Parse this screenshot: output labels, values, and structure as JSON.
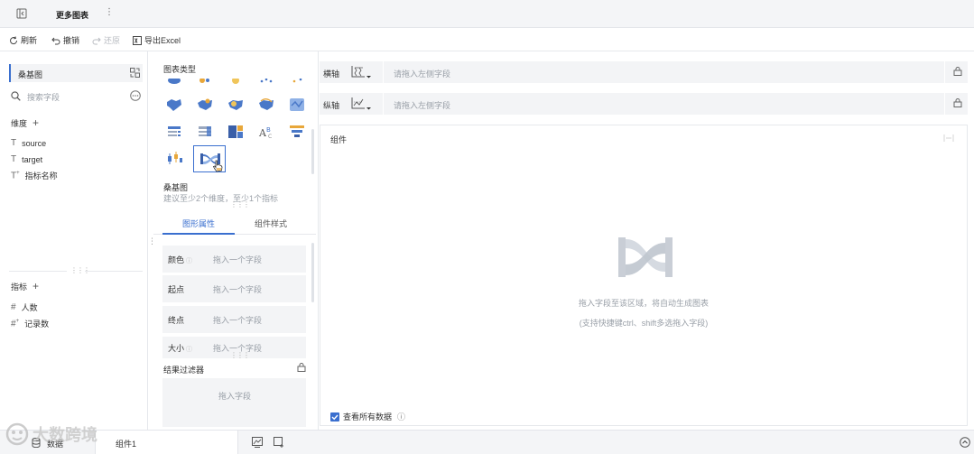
{
  "header": {
    "title": "更多图表",
    "menu_glyph": "⋮"
  },
  "toolbar": {
    "refresh": "刷新",
    "undo": "撤销",
    "redo": "还原",
    "export": "导出Excel"
  },
  "left": {
    "chart_name": "桑基图",
    "search_placeholder": "搜索字段",
    "dimension_title": "维度",
    "dimensions": [
      {
        "label": "source"
      },
      {
        "label": "target"
      },
      {
        "label": "指标名称"
      }
    ],
    "measure_title": "指标",
    "measures": [
      {
        "label": "人数"
      },
      {
        "label": "记录数"
      }
    ]
  },
  "middle": {
    "chart_type_title": "图表类型",
    "selected_chart_name": "桑基图",
    "selected_chart_hint": "建议至少2个维度，至少1个指标",
    "tabs": [
      {
        "label": "图形属性",
        "active": true
      },
      {
        "label": "组件样式",
        "active": false
      }
    ],
    "props": [
      {
        "label": "颜色",
        "hint": "拖入一个字段"
      },
      {
        "label": "起点",
        "hint": "拖入一个字段"
      },
      {
        "label": "终点",
        "hint": "拖入一个字段"
      },
      {
        "label": "大小",
        "hint": "拖入一个字段"
      }
    ],
    "filter_title": "结果过滤器",
    "filter_hint": "拖入字段"
  },
  "axes": {
    "x_label": "横轴",
    "x_placeholder": "请拖入左侧字段",
    "y_label": "纵轴",
    "y_placeholder": "请拖入左侧字段"
  },
  "canvas": {
    "title": "组件",
    "empty_line1": "拖入字段至该区域，将自动生成图表",
    "empty_line2": "(支持快捷键ctrl、shift多选拖入字段)",
    "show_all_label": "查看所有数据",
    "show_all_checked": true
  },
  "bottom": {
    "sheet_tab": "数据",
    "component_tab": "组件1"
  },
  "watermark": "大数跨境",
  "colors": {
    "accent": "#3a6fcf",
    "panel_bg": "#f3f4f6",
    "placeholder_graphic": "#c9ced6"
  }
}
